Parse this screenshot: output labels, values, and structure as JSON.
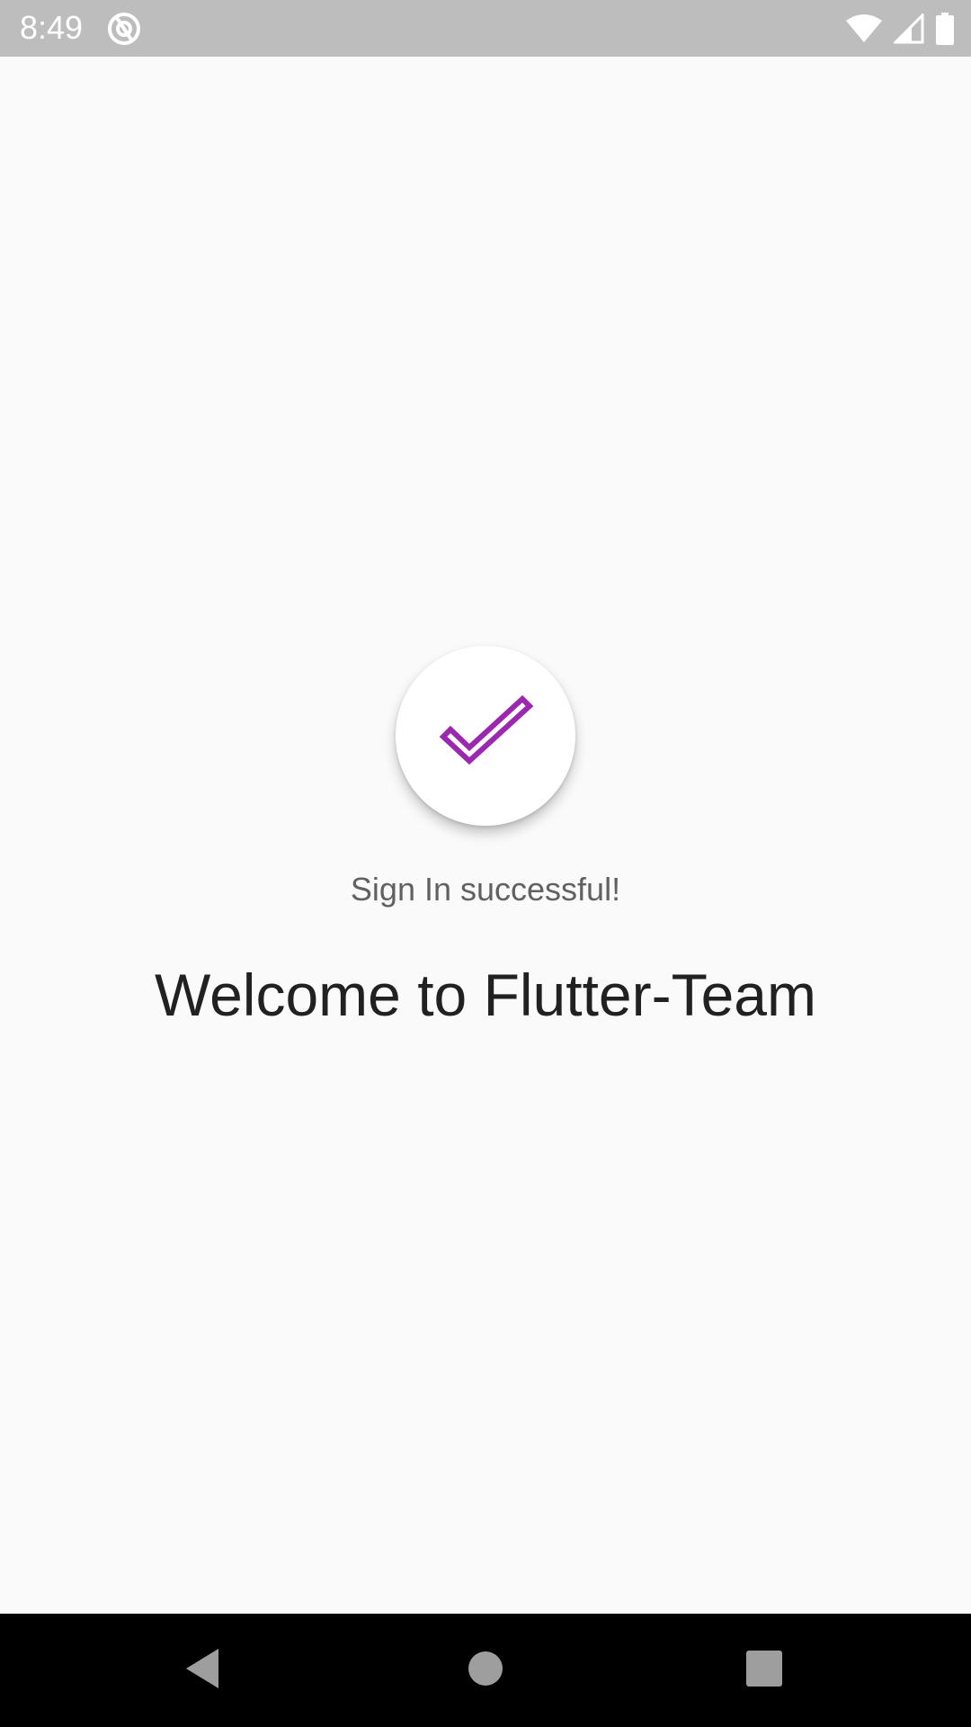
{
  "status_bar": {
    "time": "8:49",
    "app_icon": "at-sign-circle-icon",
    "icons": [
      "wifi-icon",
      "cellular-signal-icon",
      "battery-icon"
    ]
  },
  "main": {
    "success_icon": "checkmark-icon",
    "success_message": "Sign In successful!",
    "welcome_message": "Welcome to Flutter-Team"
  },
  "nav_bar": {
    "buttons": [
      "back-icon",
      "home-icon",
      "recents-icon"
    ]
  },
  "colors": {
    "accent": "#9c27b0",
    "status_bar_bg": "#bdbdbd",
    "background": "#fafafa",
    "nav_bar_bg": "#000000"
  }
}
